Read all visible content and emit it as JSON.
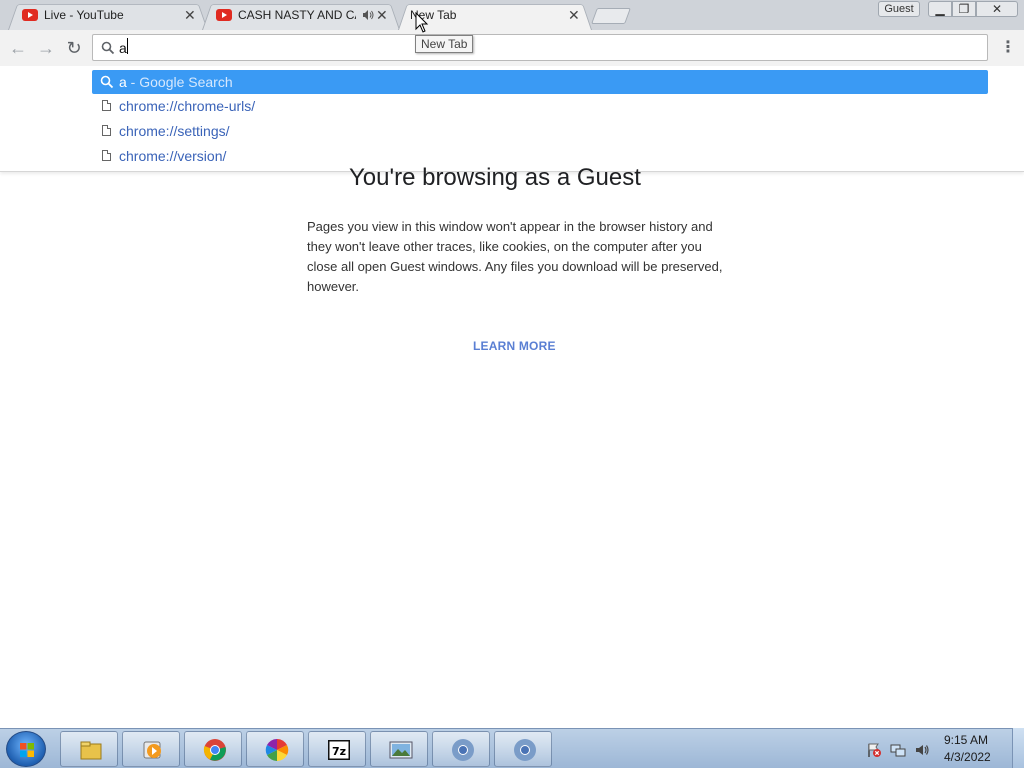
{
  "tabs": [
    {
      "title": "Live - YouTube",
      "icon": "youtube-icon"
    },
    {
      "title": "CASH NASTY AND CA",
      "icon": "youtube-icon",
      "audio": "speaker-icon"
    },
    {
      "title": "New Tab",
      "active": true
    }
  ],
  "window": {
    "profile_label": "Guest"
  },
  "omnibox": {
    "value": "a"
  },
  "tooltip": "New Tab",
  "suggestions": [
    {
      "query": "a",
      "detail": " - Google Search",
      "icon": "search-icon"
    },
    {
      "text": "chrome://chrome-urls/",
      "icon": "page-icon"
    },
    {
      "text": "chrome://settings/",
      "icon": "page-icon"
    },
    {
      "text": "chrome://version/",
      "icon": "page-icon"
    }
  ],
  "page": {
    "title": "You're browsing as a Guest",
    "body": "Pages you view in this window won't appear in the browser history and they won't leave other traces, like cookies, on the computer after you close all open Guest windows. Any files you download will be preserved, however.",
    "learn_more": "LEARN MORE"
  },
  "taskbar": {
    "apps": [
      "file-explorer-icon",
      "media-player-icon",
      "chrome-icon",
      "photos-icon",
      "7zip-icon",
      "image-viewer-icon",
      "chrome-window-icon",
      "chrome-window-icon"
    ],
    "seven_zip_label": "7z",
    "time": "9:15 AM",
    "date": "4/3/2022"
  },
  "colors": {
    "selection": "#3a9af4",
    "link": "#3a63b8",
    "learn_more": "#5a7fd3"
  }
}
